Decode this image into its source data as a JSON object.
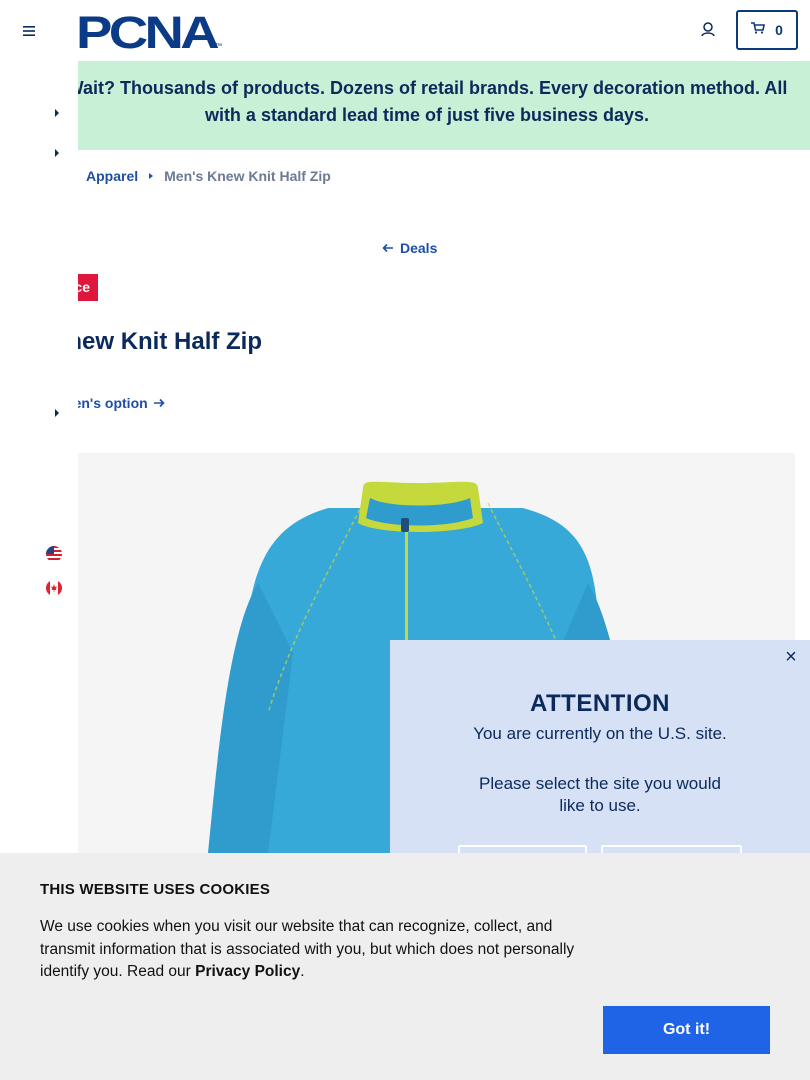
{
  "header": {
    "logo_text": "PCNA",
    "cart_count": "0"
  },
  "promo": {
    "line1": "Wait? Thousands of products. Dozens of retail brands. Every decoration method. All",
    "line2": "with a standard lead time of just five business days."
  },
  "breadcrumb": {
    "items": [
      "Apparel",
      "Men's Knew Knit Half Zip"
    ]
  },
  "back_link": "Deals",
  "badge": "ce",
  "product": {
    "title": "s Knew Knit Half Zip",
    "women_option": "e women's option",
    "colors": {
      "body": "#37a9d9",
      "collar": "#c6d93c"
    }
  },
  "locale_flags": [
    "us-flag-icon",
    "canada-flag-icon"
  ],
  "modal": {
    "title": "ATTENTION",
    "message": "You are currently on the U.S. site.",
    "prompt": "Please select the site you would like to use.",
    "close": "×"
  },
  "cookie": {
    "title": "THIS WEBSITE USES COOKIES",
    "text": "We use cookies when you visit our website that can recognize, collect, and transmit information that is associated with you, but which does not personally identify you. Read our",
    "link": "Privacy Policy",
    "period": ".",
    "button": "Got it!"
  },
  "colors": {
    "brand_navy": "#0b2a5b",
    "promo_bg": "#c7f0d6",
    "badge_red": "#e0173c",
    "button_blue": "#1f63e6",
    "modal_bg": "#d6e1f5"
  }
}
